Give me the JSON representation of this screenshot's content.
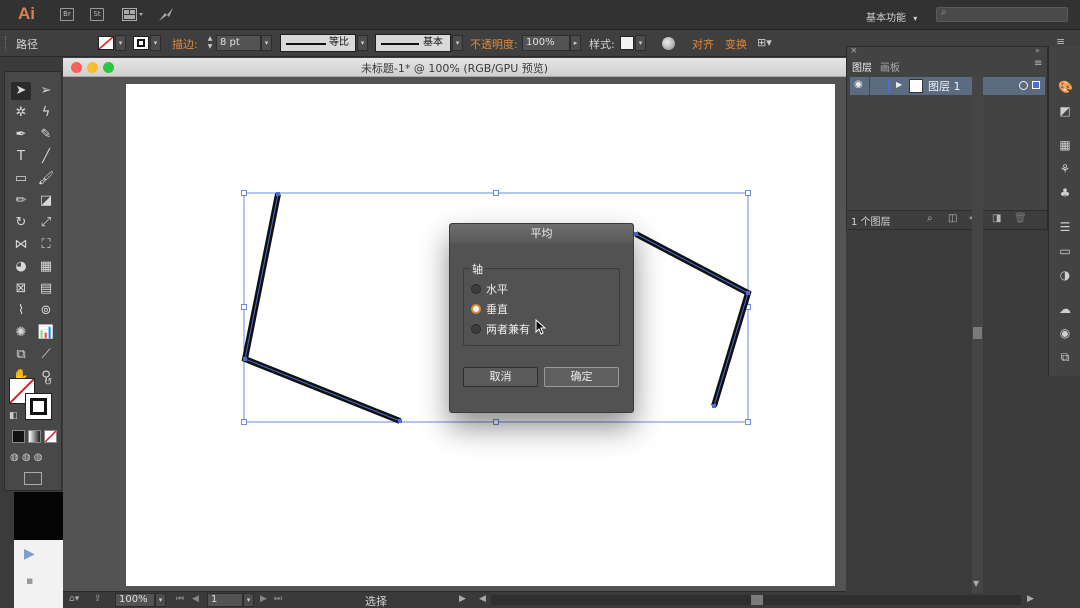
{
  "app": {
    "logo": "Ai",
    "bridge_label": "Br",
    "stock_label": "St",
    "workspace": "基本功能",
    "search_placeholder": ""
  },
  "control_bar": {
    "selection_label": "路径",
    "stroke_label": "描边:",
    "stroke_weight": "8 pt",
    "profile_uniform": "等比",
    "brush_basic": "基本",
    "opacity_label": "不透明度:",
    "opacity_value": "100%",
    "style_label": "样式:",
    "align_label": "对齐",
    "transform_label": "变换"
  },
  "document": {
    "title": "未标题-1* @ 100% (RGB/GPU 预览)",
    "zoom": "100%",
    "artboard_num": "1",
    "status_tool": "选择"
  },
  "dialog": {
    "title": "平均",
    "group_label": "轴",
    "options": [
      {
        "label": "水平",
        "checked": false
      },
      {
        "label": "垂直",
        "checked": true
      },
      {
        "label": "两者兼有",
        "checked": false
      }
    ],
    "cancel_label": "取消",
    "ok_label": "确定"
  },
  "layers_panel": {
    "tabs": [
      "图层",
      "画板"
    ],
    "layer_name": "图层 1",
    "footer_count": "1 个图层"
  },
  "colors": {
    "accent": "#e08a3c",
    "selection": "#4a6ed8",
    "layer_highlight": "#5b6b80"
  }
}
